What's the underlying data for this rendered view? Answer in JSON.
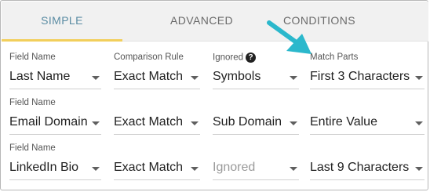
{
  "tabs": [
    "SIMPLE",
    "ADVANCED",
    "CONDITIONS"
  ],
  "active_tab": "SIMPLE",
  "headers": {
    "field_name": "Field Name",
    "comparison_rule": "Comparison Rule",
    "ignored": "Ignored",
    "match_parts": "Match Parts"
  },
  "rows": [
    {
      "field_label": "Field Name",
      "field": "Last Name",
      "rule": "Exact Match",
      "ignored": "Symbols",
      "parts": "First 3 Characters"
    },
    {
      "field_label": "Field Name",
      "field": "Email Domain",
      "rule": "Exact Match",
      "ignored": "Sub Domain",
      "parts": "Entire Value"
    },
    {
      "field_label": "Field Name",
      "field": "LinkedIn Bio",
      "rule": "Exact Match",
      "ignored": "Ignored",
      "parts": "Last 9 Characters"
    }
  ],
  "colors": {
    "active_tab_text": "#5a8ca3",
    "tab_underline": "#f2cf5c",
    "annotation_arrow": "#2bb8cc"
  },
  "icons": {
    "help": "question-circle-icon",
    "dropdown": "caret-down-icon",
    "annotation": "pointer-arrow"
  }
}
